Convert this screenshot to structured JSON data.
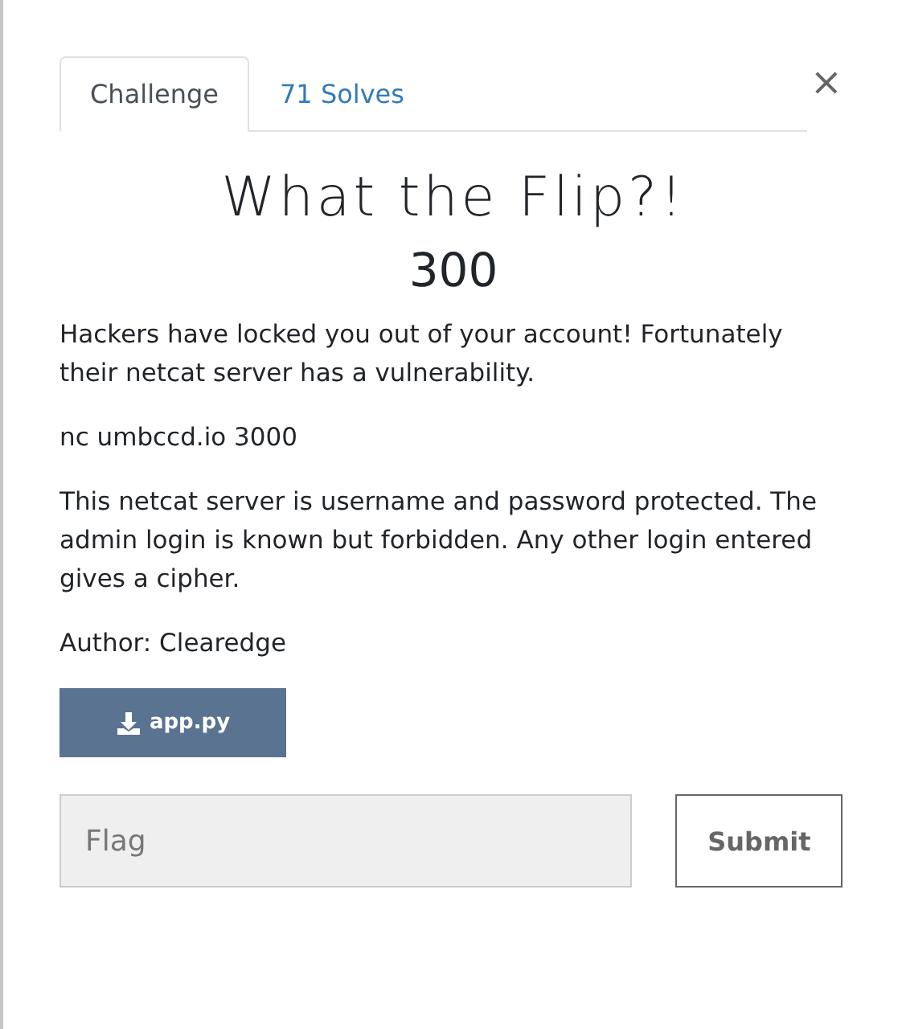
{
  "close_button": "×",
  "tabs": [
    {
      "label": "Challenge",
      "selected": true
    },
    {
      "label": "71 Solves",
      "selected": false
    }
  ],
  "challenge": {
    "title": "What the Flip?!",
    "points": "300",
    "description": [
      "Hackers have locked you out of your account! Fortunately their netcat server has a vulnerability.",
      "nc umbccd.io 3000",
      "This netcat server is username and password protected. The admin login is known but forbidden. Any other login entered gives a cipher.",
      "Author: Clearedge"
    ],
    "files": [
      "app.py"
    ]
  },
  "flag_input": {
    "placeholder": "Flag"
  },
  "submit_button": "Submit"
}
